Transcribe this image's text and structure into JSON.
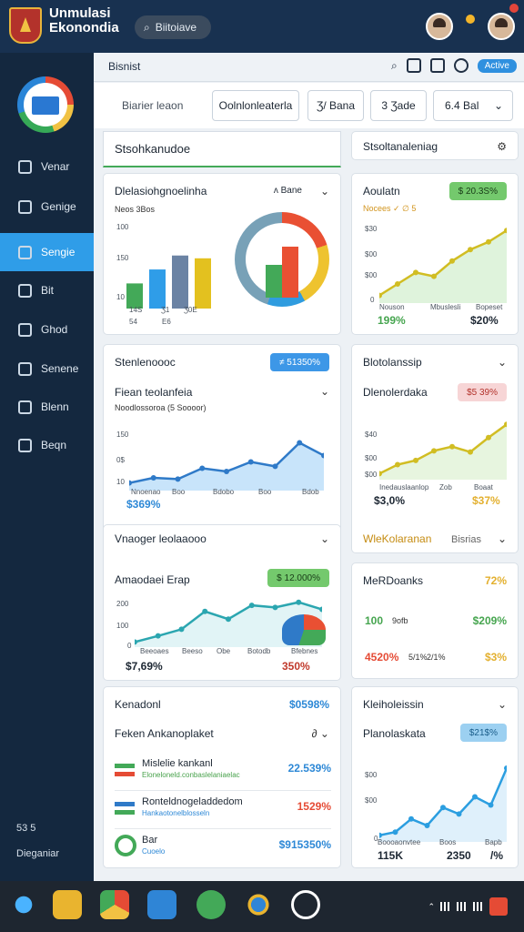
{
  "app": {
    "title_line1": "Unmulasi",
    "title_line2": "Ekonondia",
    "search": "Biitoiave"
  },
  "sidebar": {
    "items": [
      {
        "label": "Venar",
        "icon": "clock-icon"
      },
      {
        "label": "Genige",
        "icon": "chart-icon"
      },
      {
        "label": "Sengie",
        "icon": "grid-icon"
      },
      {
        "label": "Bit",
        "icon": "arrows-icon"
      },
      {
        "label": "Ghod",
        "icon": "globe-icon"
      },
      {
        "label": "Senene",
        "icon": "cross-icon"
      },
      {
        "label": "Blenn",
        "icon": "list-icon"
      },
      {
        "label": "Beqn",
        "icon": "pen-icon"
      }
    ],
    "footer_top": "53 5",
    "footer_bottom": "Dieganiar"
  },
  "topbar": {
    "title": "Bisnist",
    "pill": "Active"
  },
  "filters": {
    "text": "Biarier leaon",
    "b1": "Oolnlonleaterla",
    "b2": "Ʒ/ Bana",
    "b3": "3 Ʒade",
    "b4": "6.4 Bal"
  },
  "sections": {
    "left": "Stsohkanudoe",
    "right": "Stsoltanaleniag"
  },
  "cards": {
    "c1": {
      "title": "Dlelasiohgnoelinha",
      "tag": "ʌ Bane",
      "sub": "Neos 3Bos",
      "y": [
        "100",
        "150",
        "10"
      ],
      "x": [
        "14S",
        "Ʒ1",
        "Ʒ0E"
      ],
      "x2": [
        "54",
        "E6"
      ]
    },
    "c2": {
      "title": "Aoulatn",
      "tag": "$ 20.3S%",
      "legend": "Nocees  ✓ ∅ 5",
      "y": [
        "$30",
        "$00",
        "$00",
        "0"
      ],
      "x": [
        "Nouson",
        "Mbuslesli",
        "Bopeset"
      ],
      "v1": "199%",
      "v2": "$20%"
    },
    "c3": {
      "title": "Stenlenoooc",
      "tag": "≠ 51350%"
    },
    "c4": {
      "title": "Blotolanssip"
    },
    "c5": {
      "title": "Fiean teolanfeia",
      "sub": "Noodlossoroa (5 Soooor)",
      "y": [
        "150",
        "0$",
        "10"
      ],
      "x": [
        "Nnoenao",
        "Boo",
        "Bdobo",
        "Boo",
        "Bdob"
      ],
      "v": "$369%"
    },
    "c6": {
      "title": "Dlenolerdaka",
      "tag": "$5 39%",
      "y": [
        "$40",
        "$00",
        "$00"
      ],
      "x": [
        "Inedauslaanlop",
        "Zob",
        "Boaat"
      ],
      "v1": "$3,0%",
      "v2": "$37%"
    },
    "c7": {
      "title": "Vnaoger leolaaooo",
      "title2": "Amaodaei Erap",
      "tag": "$ 12.000%",
      "y": [
        "200",
        "100",
        "0"
      ],
      "x": [
        "Beeoaes",
        "Beeso",
        "Obe",
        "Botodb",
        "Bfebnes"
      ],
      "v1": "$7,69%",
      "v2": "350%"
    },
    "c8": {
      "title": "WleKolaranan",
      "right": "Bisrias"
    },
    "c9": {
      "title": "MeRDoanks",
      "v1": "72%",
      "v2": "100",
      "v3": "9ofb",
      "v4": "$209%",
      "v5": "4520%",
      "v6": "5/1%",
      "v7": "2/1%",
      "v8": "$3%"
    },
    "c10": {
      "title": "Kenadonl",
      "v": "$0598%",
      "sub": "Feken Ankanoplaket",
      "rows": [
        {
          "name": "Mislelie kankanl",
          "desc": "Eloneloneld.conbaslelaniaelac",
          "value": "22.539%"
        },
        {
          "name": "Ronteldnogeladdedom",
          "desc": "Hankaotonelblosseln",
          "value": "1529%"
        },
        {
          "name": "Bar",
          "desc": "Cuoelo",
          "value": "$915350%"
        }
      ]
    },
    "c11": {
      "title": "Kleiholeissin",
      "title2": "Planolaskata",
      "tag": "$21$%",
      "y": [
        "$00",
        "$00",
        "0"
      ],
      "x": [
        "Boooaonvtee",
        "Boos",
        "Bapb"
      ],
      "v1": "115K",
      "v2": "2350",
      "v3": "/%"
    }
  },
  "chart_data": [
    {
      "type": "bar",
      "title": "Dlelasiohgnoelinha",
      "categories": [
        "1",
        "2",
        "3",
        "4"
      ],
      "values": [
        45,
        70,
        95,
        90
      ],
      "ylim": [
        0,
        150
      ]
    },
    {
      "type": "line",
      "title": "Aoulatn",
      "x": [
        1,
        2,
        3,
        4,
        5,
        6,
        7,
        8
      ],
      "y": [
        10,
        25,
        40,
        35,
        55,
        70,
        80,
        95
      ],
      "ylim": [
        0,
        100
      ]
    },
    {
      "type": "line",
      "title": "Fiean teolanfeia",
      "x": [
        1,
        2,
        3,
        4,
        5,
        6,
        7,
        8,
        9
      ],
      "y": [
        12,
        20,
        18,
        35,
        30,
        45,
        38,
        75,
        55
      ],
      "ylim": [
        0,
        100
      ]
    },
    {
      "type": "line",
      "title": "Dlenolerdaka",
      "x": [
        1,
        2,
        3,
        4,
        5,
        6,
        7,
        8
      ],
      "y": [
        10,
        25,
        32,
        48,
        55,
        46,
        70,
        92
      ],
      "ylim": [
        0,
        100
      ]
    },
    {
      "type": "line",
      "title": "Amaodaei Erap",
      "x": [
        1,
        2,
        3,
        4,
        5,
        6,
        7,
        8,
        9
      ],
      "y": [
        10,
        22,
        35,
        70,
        55,
        82,
        78,
        88,
        74
      ],
      "ylim": [
        0,
        100
      ]
    },
    {
      "type": "line",
      "title": "Planolaskata",
      "x": [
        1,
        2,
        3,
        4,
        5,
        6,
        7,
        8,
        9
      ],
      "y": [
        8,
        12,
        28,
        20,
        42,
        34,
        55,
        45,
        90
      ],
      "ylim": [
        0,
        100
      ]
    }
  ]
}
